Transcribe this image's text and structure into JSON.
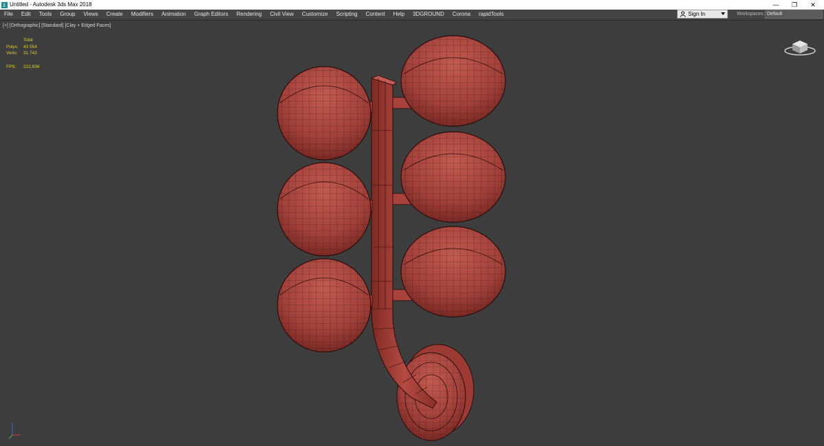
{
  "titlebar": {
    "title": "Untitled - Autodesk 3ds Max 2018",
    "minimize_glyph": "—",
    "restore_glyph": "❐",
    "close_glyph": "✕"
  },
  "menubar": {
    "items": [
      "File",
      "Edit",
      "Tools",
      "Group",
      "Views",
      "Create",
      "Modifiers",
      "Animation",
      "Graph Editors",
      "Rendering",
      "Civil View",
      "Customize",
      "Scripting",
      "Content",
      "Help",
      "3DGROUND",
      "Corona",
      "rapidTools"
    ]
  },
  "signin": {
    "label": "Sign In"
  },
  "workspaces": {
    "label": "Workspaces:",
    "value": "Default"
  },
  "viewport": {
    "label": "[+] [Orthographic] [Standard] [Clay + Edged Faces]",
    "stats": {
      "header": "Total",
      "polys_label": "Polys:",
      "polys_value": "43 554",
      "verts_label": "Verts:",
      "verts_value": "31 743",
      "fps_label": "FPS:",
      "fps_value": "222,936"
    }
  },
  "colors": {
    "viewport_bg": "#3d3d3d",
    "menubar_bg": "#444444",
    "stats_text": "#e8d21a",
    "clay": "#a8423a",
    "clay_dark": "#5c1d18",
    "wire": "#2a0c0a"
  }
}
